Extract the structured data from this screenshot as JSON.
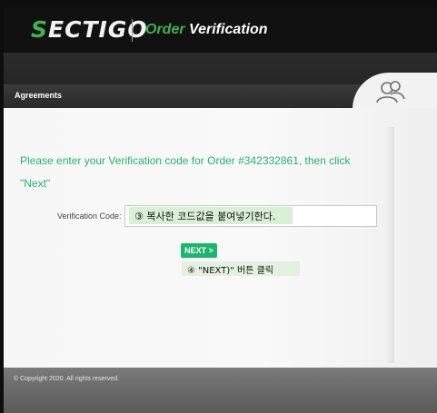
{
  "header": {
    "logo_initial": "S",
    "logo_rest": "ECTIGO",
    "title_accent": "Order",
    "title_rest": " Verification"
  },
  "nav": {
    "label": "Agreements",
    "icon": "user-group-icon"
  },
  "main": {
    "prompt": "Please enter your Verification code for Order #342332861, then click \"Next\"",
    "verification_label": "Verification Code:",
    "verification_value": "",
    "annotation_paste": "③ 복사한 코드값을 붙여넣기한다.",
    "next_label": "NEXT >",
    "annotation_next": "④ \"NEXT)\" 버튼 클릭"
  },
  "footer": {
    "copyright": "© Copyright 2020. All rights reserved."
  },
  "colors": {
    "brand_green": "#3fb34f",
    "prompt_green": "#22b477",
    "button_green": "#1db56d",
    "header_bg": "#111111",
    "footer_bg": "#6a6a6a"
  }
}
